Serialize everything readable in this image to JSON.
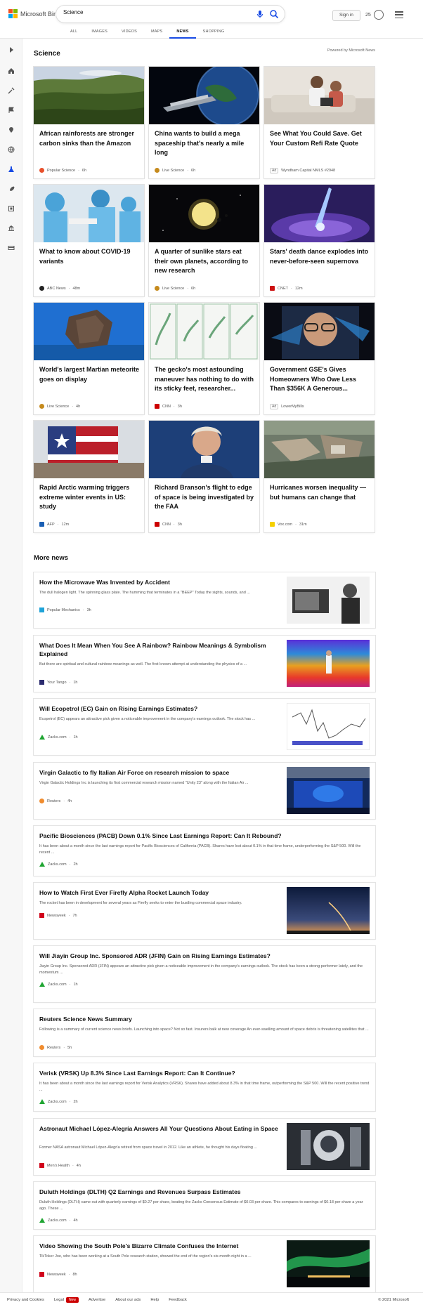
{
  "header": {
    "brand": "Microsoft Bing",
    "search_value": "Science",
    "signin": "Sign in",
    "reward_count": "25",
    "tabs": [
      "ALL",
      "IMAGES",
      "VIDEOS",
      "MAPS",
      "NEWS",
      "SHOPPING"
    ],
    "active_tab": "NEWS"
  },
  "section": {
    "title": "Science",
    "powered_by": "Powered by Microsoft News"
  },
  "cards": [
    {
      "title": "African rainforests are stronger carbon sinks than the Amazon",
      "source": "Popular Science",
      "time": "6h",
      "icon_color": "#e8502b"
    },
    {
      "title": "China wants to build a mega spaceship that's nearly a mile long",
      "source": "Live Science",
      "time": "6h",
      "icon_color": "#c58a1c"
    },
    {
      "title": "See What You Could Save. Get Your Custom Refi Rate Quote",
      "source": "Wyndham Capital NMLS #2948",
      "ad_label": "Ad",
      "icon_color": "#999999"
    },
    {
      "title": "What to know about COVID-19 variants",
      "source": "ABC News",
      "time": "48m",
      "icon_color": "#222222"
    },
    {
      "title": "A quarter of sunlike stars eat their own planets, according to new research",
      "source": "Live Science",
      "time": "6h",
      "icon_color": "#c58a1c"
    },
    {
      "title": "Stars' death dance explodes into never-before-seen supernova",
      "source": "CNET",
      "time": "12m",
      "icon_color": "#cc1111"
    },
    {
      "title": "World's largest Martian meteorite goes on display",
      "source": "Live Science",
      "time": "4h",
      "icon_color": "#c58a1c"
    },
    {
      "title": "The gecko's most astounding maneuver has nothing to do with its sticky feet, researcher...",
      "source": "CNN",
      "time": "3h",
      "icon_color": "#cc0000"
    },
    {
      "title": "Government GSE's Gives Homeowners Who Owe Less Than $356K A Generous...",
      "source": "LowerMyBills",
      "ad_label": "Ad",
      "icon_color": "#999999"
    },
    {
      "title": "Rapid Arctic warming triggers extreme winter events in US: study",
      "source": "AFP",
      "time": "12m",
      "icon_color": "#1a5fb4"
    },
    {
      "title": "Richard Branson's flight to edge of space is being investigated by the FAA",
      "source": "CNN",
      "time": "3h",
      "icon_color": "#cc0000"
    },
    {
      "title": "Hurricanes worsen inequality — but humans can change that",
      "source": "Vox.com",
      "time": "31m",
      "icon_color": "#f5d000"
    }
  ],
  "more_news": {
    "title": "More news",
    "stories": [
      {
        "title": "How the Microwave Was Invented by Accident",
        "desc": "The dull halogen light. The spinning glass plate. The humming that terminates in a \"BEEP\" Today the sights, sounds, and ...",
        "source": "Popular Mechanics",
        "time": "3h",
        "icon_color": "#1fa3d8"
      },
      {
        "title": "What Does It Mean When You See A Rainbow? Rainbow Meanings & Symbolism Explained",
        "desc": "But there are spiritual and cultural rainbow meanings as well. The first known attempt at understanding the physics of a ...",
        "source": "Your Tango",
        "time": "1h",
        "icon_color": "#2b2b6e"
      },
      {
        "title": "Will Ecopetrol (EC) Gain on Rising Earnings Estimates?",
        "desc": "Ecopetrol (EC) appears an attractive pick given a noticeable improvement in the company's earnings outlook. The stock has ...",
        "source": "Zacks.com",
        "time": "1h",
        "icon_color": "#1fa532"
      },
      {
        "title": "Virgin Galactic to fly Italian Air Force on research mission to space",
        "desc": "Virgin Galactic Holdings Inc is launching its first commercial research mission named \"Unity 23\" along with the Italian Air ...",
        "source": "Reuters",
        "time": "4h",
        "icon_color": "#f08c2e"
      },
      {
        "title": "Pacific Biosciences (PACB) Down 0.1% Since Last Earnings Report: Can It Rebound?",
        "desc": "It has been about a month since the last earnings report for Pacific Biosciences of California (PACB). Shares have lost about 0.1% in that time frame, underperforming the S&P 500. Will the recent ...",
        "source": "Zacks.com",
        "time": "2h",
        "icon_color": "#1fa532"
      },
      {
        "title": "How to Watch First Ever Firefly Alpha Rocket Launch Today",
        "desc": "The rocket has been in development for several years as Firefly seeks to enter the bustling commercial space industry.",
        "source": "Newsweek",
        "time": "7h",
        "icon_color": "#d0021b"
      },
      {
        "title": "Will Jiayin Group Inc. Sponsored ADR (JFIN) Gain on Rising Earnings Estimates?",
        "desc": "Jiayin Group Inc. Sponsored ADR (JFIN) appears an attractive pick given a noticeable improvement in the company's earnings outlook. The stock has been a strong performer lately, and the momentum ...",
        "source": "Zacks.com",
        "time": "1h",
        "icon_color": "#1fa532"
      },
      {
        "title": "Reuters Science News Summary",
        "desc": "Following is a summary of current science news briefs. Launching into space? Not so fast. Insurers balk at new coverage An ever-swelling amount of space debris is threatening satellites that ...",
        "source": "Reuters",
        "time": "5h",
        "icon_color": "#f08c2e"
      },
      {
        "title": "Verisk (VRSK) Up 8.3% Since Last Earnings Report: Can It Continue?",
        "desc": "It has been about a month since the last earnings report for Verisk Analytics (VRSK). Shares have added about 8.3% in that time frame, outperforming the S&P 500. Will the recent positive trend ...",
        "source": "Zacks.com",
        "time": "2h",
        "icon_color": "#1fa532"
      },
      {
        "title": "Astronaut Michael López-Alegría Answers All Your Questions About Eating in Space",
        "desc": "Former NASA astronaut Michael López-Alegría retired from space travel in 2012. Like an athlete, he thought his days floating ...",
        "source": "Men's Health",
        "time": "4h",
        "icon_color": "#d0021b"
      },
      {
        "title": "Duluth Holdings (DLTH) Q2 Earnings and Revenues Surpass Estimates",
        "desc": "Duluth Holdings (DLTH) came out with quarterly earnings of $0.27 per share, beating the Zacks Consensus Estimate of $0.03 per share. This compares to earnings of $0.18 per share a year ago. These ...",
        "source": "Zacks.com",
        "time": "4h",
        "icon_color": "#1fa532"
      },
      {
        "title": "Video Showing the South Pole's Bizarre Climate Confuses the Internet",
        "desc": "TikToker Joe, who has been working at a South Pole research station, showed the end of the region's six-month night in a ...",
        "source": "Newsweek",
        "time": "8h",
        "icon_color": "#d0021b"
      }
    ]
  },
  "footer": {
    "links": [
      "Privacy and Cookies",
      "Legal",
      "Advertise",
      "About our ads",
      "Help",
      "Feedback"
    ],
    "new_badge": "New",
    "copyright": "© 2021 Microsoft"
  }
}
